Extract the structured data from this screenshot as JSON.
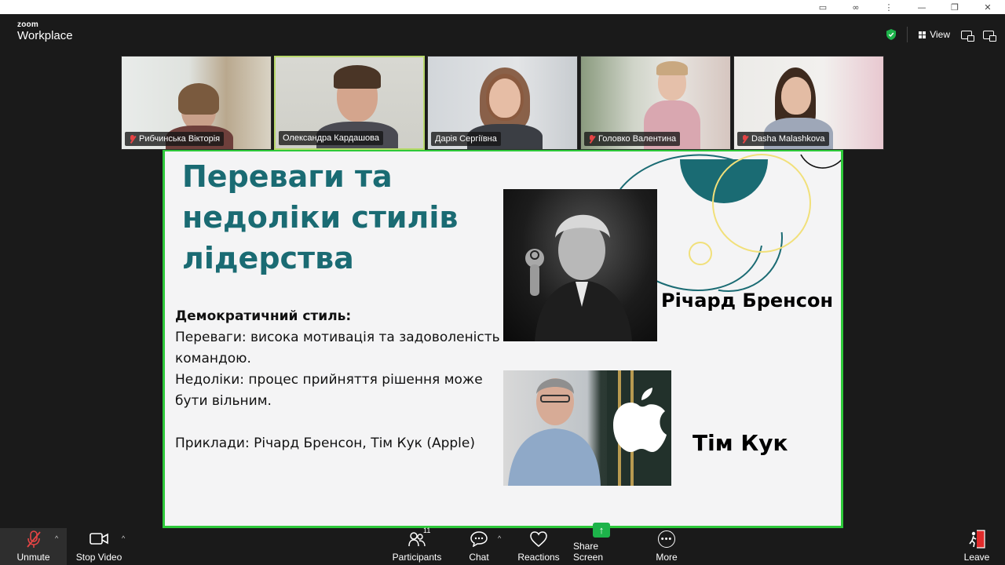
{
  "app": {
    "brand_top": "zoom",
    "brand_bottom": "Workplace",
    "view_label": "View"
  },
  "window_controls": [
    "minimize",
    "restore",
    "close"
  ],
  "participants": [
    {
      "name": "Рибчинська Вікторія",
      "muted": true
    },
    {
      "name": "Олександра Кардашова",
      "muted": false,
      "active": true
    },
    {
      "name": "Дарія Сергіївна",
      "muted": false
    },
    {
      "name": "Головко Валентина",
      "muted": true
    },
    {
      "name": "Dasha Malashkova",
      "muted": true
    }
  ],
  "slide": {
    "title": "Переваги та недоліки стилів лідерства",
    "heading": "Демократичний стиль:",
    "pros": "Переваги: висока мотивація та задоволеність командою.",
    "cons": "Недоліки: процес прийняття рішення може бути вільним.",
    "examples": "Приклади: Річард Бренсон, Тім Кук (Apple)",
    "caption_1": "Річард Бренсон",
    "caption_2": "Тім Кук"
  },
  "toolbar": {
    "unmute": "Unmute",
    "stop_video": "Stop Video",
    "participants": "Participants",
    "participants_count": "11",
    "chat": "Chat",
    "reactions": "Reactions",
    "share_screen": "Share Screen",
    "more": "More",
    "leave": "Leave"
  },
  "colors": {
    "slide_title": "#1a6b73",
    "slide_border": "#2ec93a",
    "active_tile_border": "#b8d86b",
    "muted_mic": "#e54545",
    "share_green": "#1db34a",
    "leave_red": "#e02b2b"
  }
}
